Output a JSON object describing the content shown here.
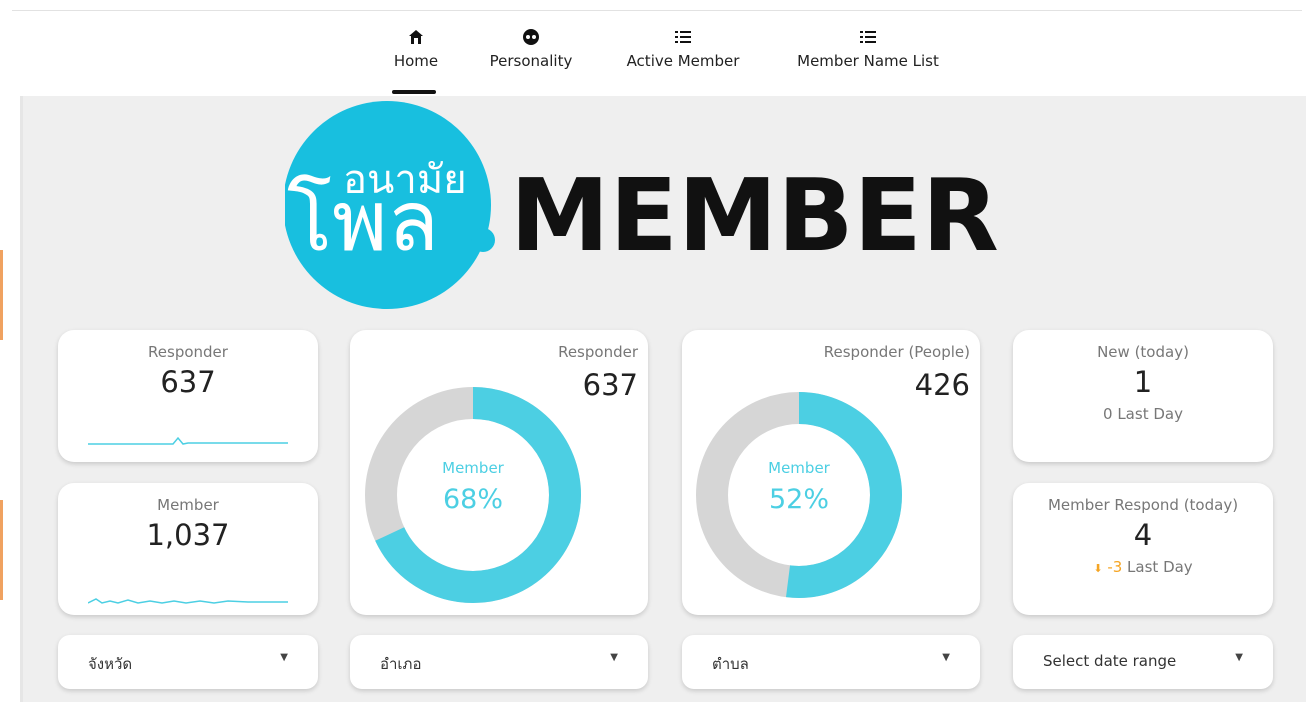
{
  "nav": {
    "tabs": [
      {
        "label": "Home",
        "icon": "home-icon"
      },
      {
        "label": "Personality",
        "icon": "face-icon"
      },
      {
        "label": "Active Member",
        "icon": "list-icon"
      },
      {
        "label": "Member Name List",
        "icon": "list-icon"
      }
    ],
    "active_tab": "Home"
  },
  "logo": {
    "thai_text": "อนามัย",
    "brand_text": "โพล",
    "member_text": "MEMBER",
    "circle_color": "#18bfdf"
  },
  "cards": {
    "responder": {
      "title": "Responder",
      "value": "637"
    },
    "member": {
      "title": "Member",
      "value": "1,037"
    },
    "responder_donut": {
      "title": "Responder",
      "value": "637",
      "center_label": "Member",
      "center_value": "68%",
      "percent": 68
    },
    "responder_people": {
      "title": "Responder (People)",
      "value": "426",
      "center_label": "Member",
      "center_value": "52%",
      "percent": 52
    },
    "new_today": {
      "title": "New (today)",
      "value": "1",
      "sub": "0 Last Day"
    },
    "member_respond": {
      "title": "Member Respond (today)",
      "value": "4",
      "delta": "-3",
      "delta_suffix": " Last Day"
    }
  },
  "filters": {
    "province": "จังหวัด",
    "district": "อำเภอ",
    "subdistrict": "ตำบล",
    "date_range": "Select date range"
  },
  "colors": {
    "accent": "#4ccfe3",
    "donut_bg": "#d6d6d6",
    "down_arrow": "#f5a524"
  }
}
